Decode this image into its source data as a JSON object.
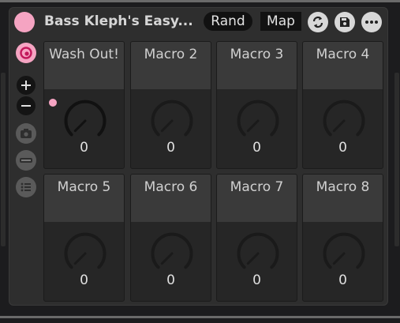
{
  "device": {
    "title": "Bass Kleph's Easy...",
    "rand_label": "Rand",
    "map_label": "Map",
    "accent_color": "#f5a4c2"
  },
  "toolbar_icons": [
    "power-icon",
    "swap-icon",
    "save-icon",
    "more-icon"
  ],
  "sidebar_icons": [
    "pink-circle-icon",
    "plus-icon",
    "minus-icon",
    "camera-icon",
    "bar-icon",
    "list-icon"
  ],
  "macros": [
    {
      "name": "Wash Out!",
      "value": "0",
      "active": true
    },
    {
      "name": "Macro 2",
      "value": "0",
      "active": false
    },
    {
      "name": "Macro 3",
      "value": "0",
      "active": false
    },
    {
      "name": "Macro 4",
      "value": "0",
      "active": false
    },
    {
      "name": "Macro 5",
      "value": "0",
      "active": false
    },
    {
      "name": "Macro 6",
      "value": "0",
      "active": false
    },
    {
      "name": "Macro 7",
      "value": "0",
      "active": false
    },
    {
      "name": "Macro 8",
      "value": "0",
      "active": false
    }
  ]
}
